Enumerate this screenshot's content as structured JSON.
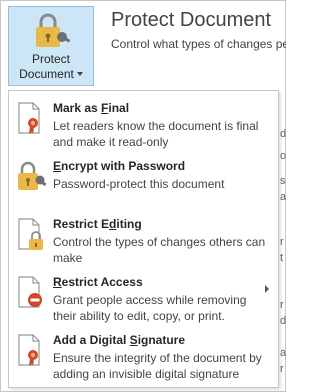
{
  "backstage": {
    "button_label": "Protect",
    "button_label_line2": "Document",
    "title": "Protect Document",
    "description": "Control what types of changes pe"
  },
  "menu": {
    "items": [
      {
        "title_pre": "Mark as ",
        "title_key": "F",
        "title_post": "inal",
        "subtitle": "Let readers know the document is final and make it read-only",
        "icon": "mark-as-final-icon"
      },
      {
        "title_pre": "",
        "title_key": "E",
        "title_post": "ncrypt with Password",
        "subtitle": "Password-protect this document",
        "icon": "encrypt-lock-key-icon"
      },
      {
        "title_pre": "Restrict E",
        "title_key": "d",
        "title_post": "iting",
        "subtitle": "Control the types of changes others can make",
        "icon": "restrict-editing-icon"
      },
      {
        "title_pre": "",
        "title_key": "R",
        "title_post": "estrict Access",
        "subtitle": "Grant people access while removing their ability to edit, copy, or print.",
        "icon": "restrict-access-icon",
        "has_submenu": true
      },
      {
        "title_pre": "Add a Digital ",
        "title_key": "S",
        "title_post": "ignature",
        "subtitle": "Ensure the integrity of the document by adding an invisible digital signature",
        "icon": "digital-signature-icon"
      }
    ]
  },
  "peek_text": [
    "d",
    "o",
    "s",
    "a",
    "r",
    "t",
    "r",
    "d",
    "a",
    "r"
  ],
  "colors": {
    "button_bg": "#cde6f7",
    "button_border": "#92c0e0",
    "lock_gold": "#e8b84a",
    "ribbon_red": "#d24726",
    "text": "#444444"
  }
}
